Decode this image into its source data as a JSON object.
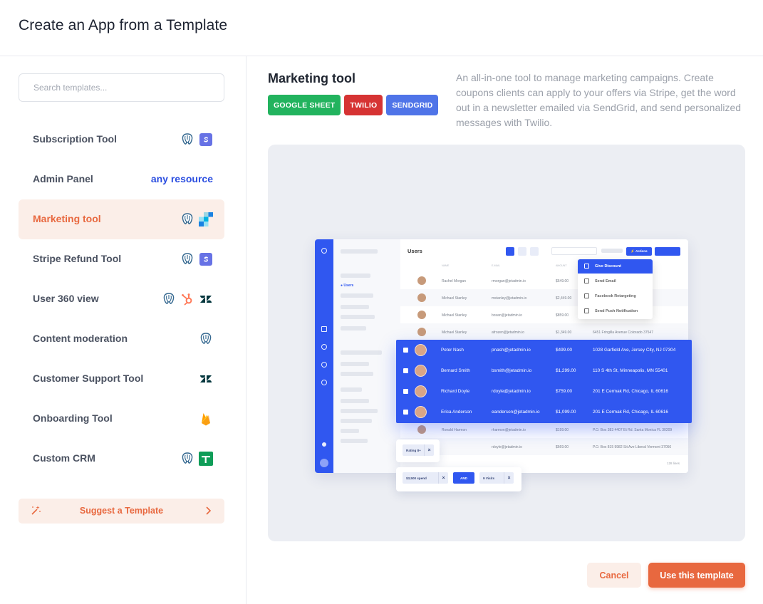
{
  "header": {
    "title": "Create an App from a Template"
  },
  "search": {
    "placeholder": "Search templates..."
  },
  "templates": [
    {
      "name": "Subscription Tool",
      "icons": [
        "postgresql-icon",
        "stripe-icon"
      ]
    },
    {
      "name": "Admin Panel",
      "tag": "any resource"
    },
    {
      "name": "Marketing tool",
      "icons": [
        "postgresql-icon",
        "sendgrid-icon"
      ],
      "active": true
    },
    {
      "name": "Stripe Refund Tool",
      "icons": [
        "postgresql-icon",
        "stripe-icon"
      ]
    },
    {
      "name": "User 360 view",
      "icons": [
        "postgresql-icon",
        "hubspot-icon",
        "zendesk-icon"
      ]
    },
    {
      "name": "Content moderation",
      "icons": [
        "postgresql-icon"
      ]
    },
    {
      "name": "Customer Support Tool",
      "icons": [
        "zendesk-icon"
      ]
    },
    {
      "name": "Onboarding Tool",
      "icons": [
        "firebase-icon"
      ]
    },
    {
      "name": "Custom CRM",
      "icons": [
        "postgresql-icon",
        "google-sheets-icon"
      ]
    }
  ],
  "suggest": {
    "label": "Suggest a Template"
  },
  "detail": {
    "title": "Marketing tool",
    "tags": [
      {
        "label": "GOOGLE SHEET",
        "color": "#22b35e"
      },
      {
        "label": "TWILIO",
        "color": "#d63333"
      },
      {
        "label": "SENDGRID",
        "color": "#4f74e8"
      }
    ],
    "description": "An all-in-one tool to manage marketing campaigns. Create coupons clients can apply to your offers via Stripe, get the word out in a newsletter emailed via SendGrid, and send personalized messages with Twilio."
  },
  "preview": {
    "heading": "Users",
    "nav_item": "Users",
    "actions_label": "Actions",
    "columns": [
      "NAME",
      "E-MAIL",
      "AMOUNT"
    ],
    "rows": [
      {
        "name": "Rachel Morgan",
        "email": "rmorgan@jetadmin.io",
        "amount": "$649.00",
        "address": ""
      },
      {
        "name": "Michael Stanley",
        "email": "mstanley@jetadmin.io",
        "amount": "$2,449.00",
        "address": ""
      },
      {
        "name": "Michael Stanley",
        "email": "bosan@jetadmin.io",
        "amount": "$859.00",
        "address": ""
      },
      {
        "name": "Michael Stanley",
        "email": "afrozen@jetadmin.io",
        "amount": "$1,349.00",
        "address": "6451 Fringilla Avenue Colorado 37547"
      }
    ],
    "selected_rows": [
      {
        "name": "Peter Nash",
        "email": "pnash@jetadmin.io",
        "amount": "$499.00",
        "address": "1028 Garfield Ave, Jersey City, NJ 07304"
      },
      {
        "name": "Bernard Smith",
        "email": "bsmith@jetadmin.io",
        "amount": "$1,299.00",
        "address": "110 S 4th St, Minneapolis, MN 55401"
      },
      {
        "name": "Richard Doyle",
        "email": "rdoyle@jetadmin.io",
        "amount": "$759.00",
        "address": "201 E Cermak Rd, Chicago, IL 60616"
      },
      {
        "name": "Erica Anderson",
        "email": "eanderson@jetadmin.io",
        "amount": "$1,099.00",
        "address": "201 E Cermak Rd, Chicago, IL 60616"
      }
    ],
    "bottom_rows": [
      {
        "name": "Ronald Harmon",
        "email": "rharmon@jetadmin.io",
        "amount": "$199.00",
        "address": "P.O. Box 383 4407 Et Rd. Santa Monica FL 30209"
      },
      {
        "name": "",
        "email": "rdoyle@jetadmin.io",
        "amount": "$669.00",
        "address": "P.O. Box 815 9982 Sit Ave Liberal Vermont 37056"
      }
    ],
    "footer_count": "128 lines",
    "menu": [
      "Give Discount",
      "Send Email",
      "Facebook Retargeting",
      "Send Push Notification"
    ],
    "filters": {
      "rating": "Rating 8+",
      "spend": "$3,500 spend",
      "operator": "AND",
      "visits": "9 Visits",
      "remove": "×"
    }
  },
  "buttons": {
    "cancel": "Cancel",
    "use": "Use this template"
  },
  "colors": {
    "accent": "#e8683f",
    "accent_bg": "#fbeee8",
    "link": "#2b4ee0",
    "app_blue": "#3057f0"
  }
}
